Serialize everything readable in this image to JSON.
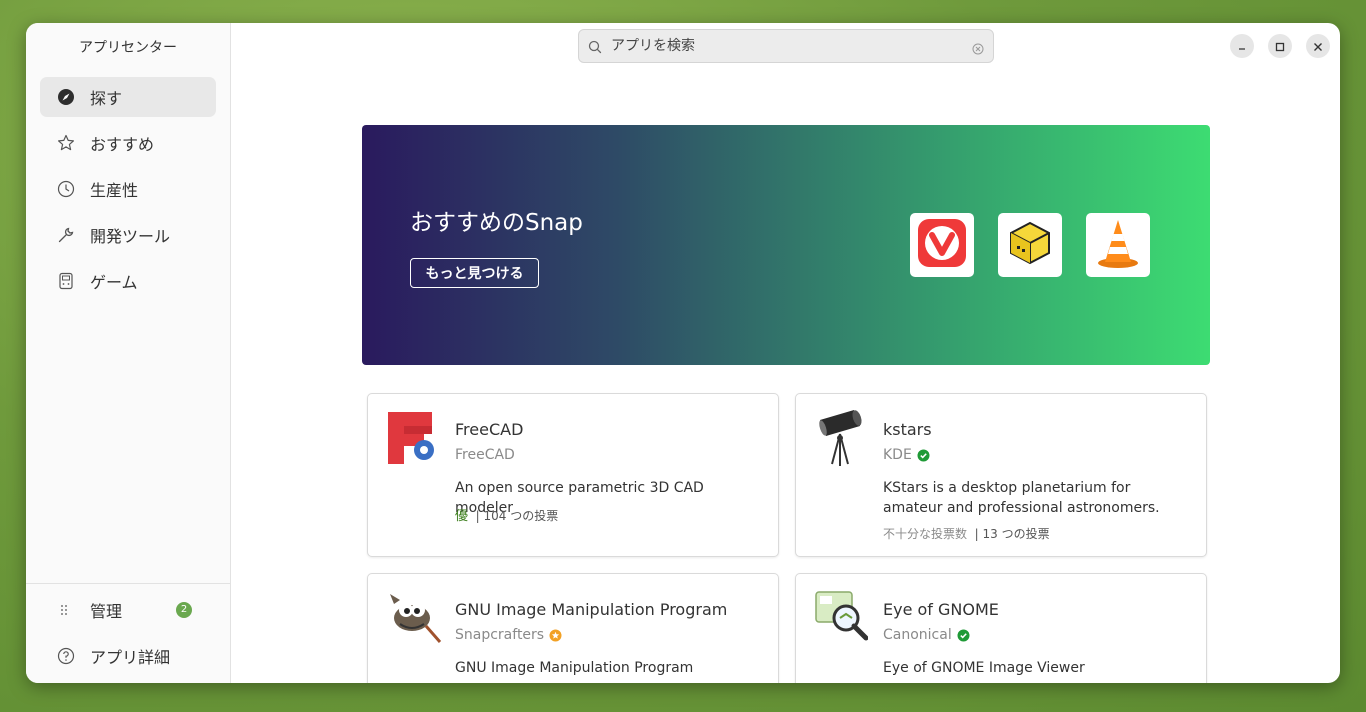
{
  "sidebar": {
    "title": "アプリセンター",
    "items": [
      {
        "label": "探す",
        "icon": "compass-icon"
      },
      {
        "label": "おすすめ",
        "icon": "star-icon"
      },
      {
        "label": "生産性",
        "icon": "clock-icon"
      },
      {
        "label": "開発ツール",
        "icon": "wrench-icon"
      },
      {
        "label": "ゲーム",
        "icon": "gamepad-icon"
      }
    ],
    "manage_label": "管理",
    "manage_badge": "2",
    "about_label": "アプリ詳細"
  },
  "search": {
    "placeholder": "アプリを検索",
    "value": ""
  },
  "banner": {
    "title": "おすすめのSnap",
    "button_label": "もっと見つける",
    "apps": [
      "vivaldi",
      "cube-app",
      "vlc"
    ]
  },
  "cards": [
    {
      "name": "FreeCAD",
      "publisher": "FreeCAD",
      "verified": false,
      "description": "An open source parametric 3D CAD modeler",
      "rating_label": "優",
      "votes": "| 104 つの投票"
    },
    {
      "name": "kstars",
      "publisher": "KDE",
      "verified": true,
      "description": "KStars is a desktop planetarium for amateur and professional astronomers.",
      "rating_label": "不十分な投票数",
      "votes": "| 13 つの投票"
    },
    {
      "name": "GNU Image Manipulation Program",
      "publisher": "Snapcrafters",
      "starred": true,
      "description": "GNU Image Manipulation Program"
    },
    {
      "name": "Eye of GNOME",
      "publisher": "Canonical",
      "verified": true,
      "description": "Eye of GNOME Image Viewer"
    }
  ],
  "colors": {
    "verified": "#1f9a36",
    "star_badge": "#f2a125",
    "badge_bg": "#6aa84f"
  }
}
